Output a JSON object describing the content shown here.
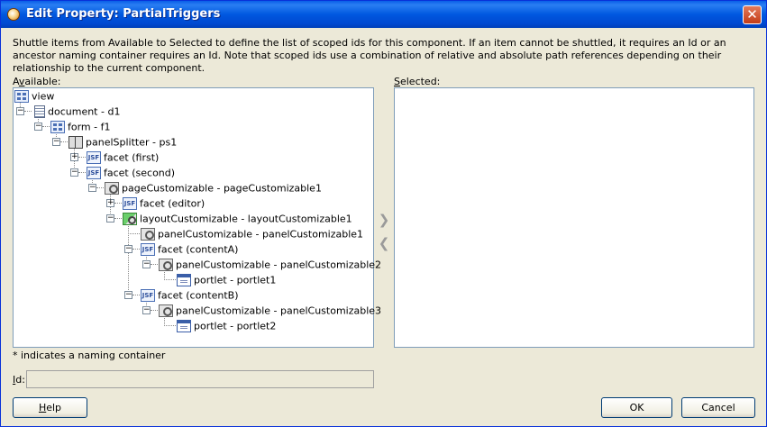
{
  "window": {
    "title": "Edit Property: PartialTriggers",
    "close_glyph": "✕"
  },
  "instructions": "Shuttle items from Available to Selected to define the list of scoped ids for this component. If an item cannot be shuttled, it requires an Id or an ancestor naming container requires an Id. Note that scoped ids use a combination of relative and absolute path references depending on their relationship to the current component.",
  "available": {
    "label_prefix": "A",
    "label_underlined": "v",
    "label_rest": "ailable:"
  },
  "selected": {
    "label_underlined": "S",
    "label_rest": "elected:"
  },
  "tree": [
    {
      "label": "view",
      "icon": "grid-icon"
    },
    {
      "label": "document - d1",
      "icon": "document-icon"
    },
    {
      "label": "form - f1",
      "icon": "grid-icon"
    },
    {
      "label": "panelSplitter - ps1",
      "icon": "splitter-icon"
    },
    {
      "label": "facet (first)",
      "icon": "jsf-facet-icon"
    },
    {
      "label": "facet (second)",
      "icon": "jsf-facet-icon"
    },
    {
      "label": "pageCustomizable - pageCustomizable1",
      "icon": "customizable-icon"
    },
    {
      "label": "facet (editor)",
      "icon": "jsf-facet-icon"
    },
    {
      "label": "layoutCustomizable - layoutCustomizable1",
      "icon": "layout-customizable-icon"
    },
    {
      "label": "panelCustomizable - panelCustomizable1",
      "icon": "customizable-icon"
    },
    {
      "label": "facet (contentA)",
      "icon": "jsf-facet-icon"
    },
    {
      "label": "panelCustomizable - panelCustomizable2",
      "icon": "customizable-icon"
    },
    {
      "label": "portlet - portlet1",
      "icon": "portlet-icon"
    },
    {
      "label": "facet (contentB)",
      "icon": "jsf-facet-icon"
    },
    {
      "label": "panelCustomizable - panelCustomizable3",
      "icon": "customizable-icon"
    },
    {
      "label": "portlet - portlet2",
      "icon": "portlet-icon"
    }
  ],
  "jsf_icon_text": "JSF",
  "shuttle": {
    "add_glyph": "❯",
    "remove_glyph": "❮"
  },
  "naming_note": "* indicates a naming container",
  "id_field": {
    "label_underlined": "I",
    "label_rest": "d:",
    "value": ""
  },
  "buttons": {
    "help_underlined": "H",
    "help_rest": "elp",
    "ok": "OK",
    "cancel": "Cancel"
  }
}
